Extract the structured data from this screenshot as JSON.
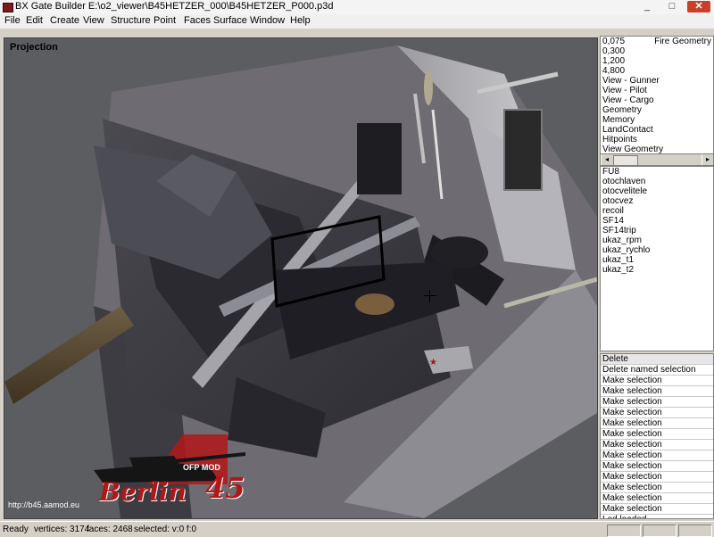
{
  "window": {
    "title": "BX Gate Builder  E:\\o2_viewer\\B45HETZER_000\\B45HETZER_P000.p3d",
    "controls": {
      "minimize": "_",
      "maximize": "□",
      "close": "✕"
    }
  },
  "menu": [
    "File",
    "Edit",
    "Create",
    "View",
    "Structure",
    "Point",
    "Faces",
    "Surface",
    "Window",
    "Help"
  ],
  "viewport": {
    "label": "Projection",
    "logo": {
      "mod": "OFP MOD",
      "name": "Berlin",
      "number": "45",
      "url": "http://b45.aamod.eu"
    }
  },
  "lod_panel": {
    "column2_header": "Fire Geometry",
    "items": [
      "0,075",
      "0,300",
      "1,200",
      "4,800",
      "View - Gunner",
      "View - Pilot",
      "View - Cargo",
      "Geometry",
      "Memory",
      "LandContact",
      "Hitpoints",
      "View Geometry"
    ],
    "scroll_left": "◂",
    "scroll_right": "▸"
  },
  "selections": [
    "FU8",
    "otochlaven",
    "otocvelitele",
    "otocvez",
    "recoil",
    "SF14",
    "SF14trip",
    "ukaz_rpm",
    "ukaz_rychlo",
    "ukaz_t1",
    "ukaz_t2"
  ],
  "history": [
    "Delete",
    "Delete named selection",
    "Make selection",
    "Make selection",
    "Make selection",
    "Make selection",
    "Make selection",
    "Make selection",
    "Make selection",
    "Make selection",
    "Make selection",
    "Make selection",
    "Make selection",
    "Make selection",
    "Make selection",
    "Lod loaded"
  ],
  "status": {
    "ready": "Ready",
    "vertices": "vertices: 3174",
    "faces": "faces: 2468",
    "selected": "selected: v:0 f:0"
  },
  "colors": {
    "viewport_bg": "#5c5d60",
    "logo_red": "#b01818",
    "hull": "#6e6c72"
  }
}
